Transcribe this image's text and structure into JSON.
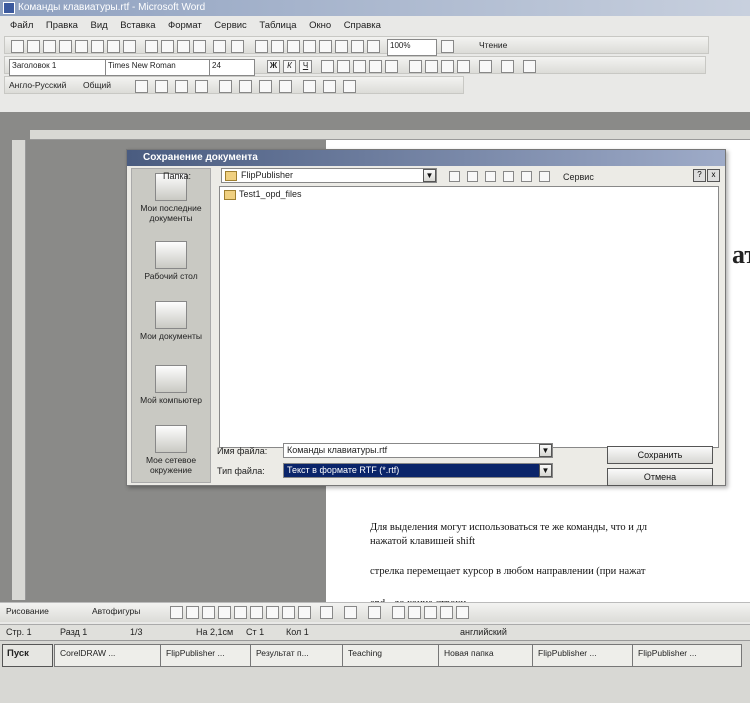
{
  "window": {
    "title": "Команды клавиатуры.rtf - Microsoft Word"
  },
  "menu": [
    "Файл",
    "Правка",
    "Вид",
    "Вставка",
    "Формат",
    "Сервис",
    "Таблица",
    "Окно",
    "Справка"
  ],
  "toolbar": {
    "style": "Заголовок 1",
    "font": "Times New Roman",
    "size": "24",
    "zoom": "100%",
    "read_label": "Чтение",
    "keyboard": "Англо-Русский",
    "common": "Общий"
  },
  "dialog": {
    "title": "Сохранение документа",
    "folder_label": "Папка:",
    "folder_value": "FlipPublisher",
    "tools_label": "Сервис",
    "help": "?",
    "close": "x",
    "places": [
      {
        "label": "Мои последние документы"
      },
      {
        "label": "Рабочий стол"
      },
      {
        "label": "Мои документы"
      },
      {
        "label": "Мой компьютер"
      },
      {
        "label": "Мое сетевое окружение"
      }
    ],
    "files": [
      "Test1_opd_files"
    ],
    "filename_label": "Имя файла:",
    "filename_value": "Команды клавиатуры.rtf",
    "filetype_label": "Тип файла:",
    "filetype_value": "Текст в формате RTF (*.rtf)",
    "save_button": "Сохранить",
    "cancel_button": "Отмена"
  },
  "document": {
    "heading_fragment": "ат",
    "line1": "Для выделения могут использоваться те же команды, что и дл",
    "line2": "нажатой клавишей shift",
    "line3": "стрелка перемещает курсор в любом направлении (при нажат",
    "line4": "end - до конца строки"
  },
  "drawbar": {
    "draw": "Рисование",
    "autoshapes": "Автофигуры"
  },
  "status": {
    "page": "Стр. 1",
    "section": "Разд 1",
    "pages": "1/3",
    "at": "На 2,1см",
    "line": "Ст 1",
    "col": "Кол 1",
    "lang": "английский"
  },
  "taskbar": {
    "start": "Пуск",
    "tasks": [
      "CorelDRAW ...",
      "FlipPublisher ...",
      "Результат п...",
      "Teaching",
      "Новая папка",
      "FlipPublisher ...",
      "FlipPublisher ..."
    ]
  }
}
